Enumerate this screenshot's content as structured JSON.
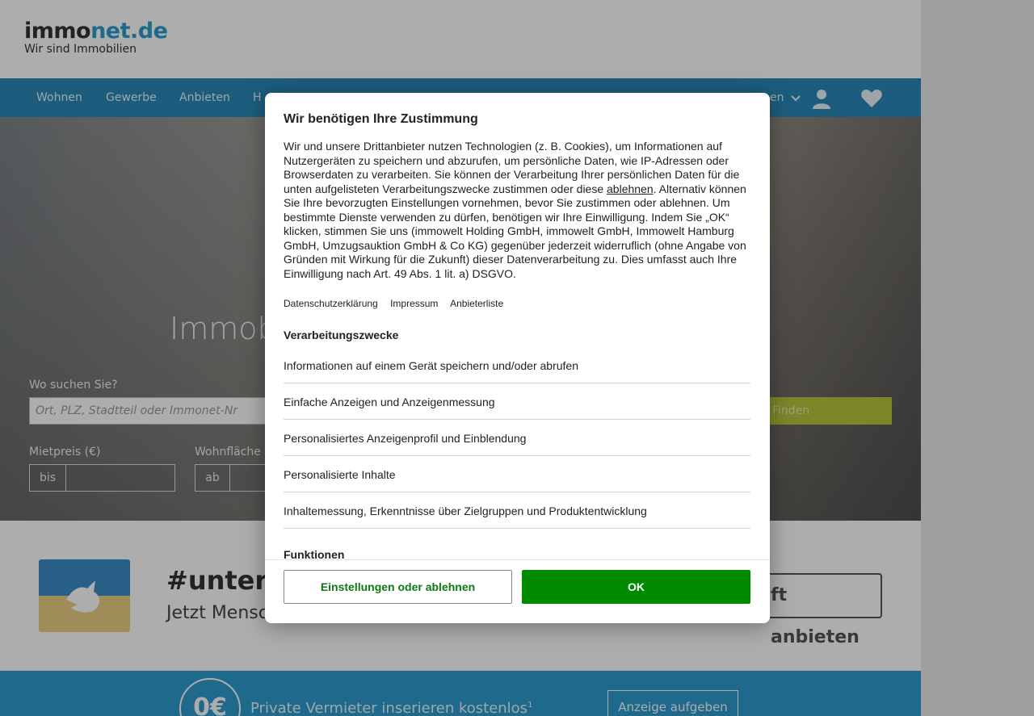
{
  "logo": {
    "brand_part1": "immo",
    "brand_part2": "net.de",
    "tagline": "Wir sind Immobilien"
  },
  "nav": {
    "items": [
      {
        "label": "Wohnen"
      },
      {
        "label": "Gewerbe"
      },
      {
        "label": "Anbieten"
      },
      {
        "label": "H"
      }
    ],
    "partial_right": "en",
    "icons": [
      "chevron-down-icon",
      "user-icon",
      "heart-icon"
    ]
  },
  "hero": {
    "title": "Immob",
    "search_label": "Wo suchen Sie?",
    "search_placeholder": "Ort, PLZ, Stadtteil oder Immonet-Nr",
    "find_label": "Finden",
    "rent_label": "Mietpreis (€)",
    "rent_prefix": "bis",
    "area_label": "Wohnfläche",
    "area_prefix": "ab"
  },
  "banner": {
    "title": "#unterk",
    "subtitle": "Jetzt Mensc",
    "button_label": "ft anbieten",
    "colors": {
      "flag_top": "#3c8dc6",
      "flag_bottom": "#ead083"
    }
  },
  "strip": {
    "badge": "0€",
    "text": "Private Vermieter inserieren kostenlos",
    "footnote_marker": "1",
    "button_label": "Anzeige aufgeben"
  },
  "consent": {
    "title": "Wir benötigen Ihre Zustimmung",
    "body_before": "Wir und unsere Drittanbieter nutzen Technologien (z. B. Cookies), um Informationen auf Nutzergeräten zu speichern und abzurufen, um persönliche Daten, wie IP-Adressen oder Browserdaten zu verarbeiten. Sie können der Verarbeitung Ihrer persönlichen Daten für die unten aufgelisteten Verarbeitungszwecke zustimmen oder diese ",
    "body_link": "ablehnen",
    "body_after": ". Alternativ können Sie Ihre bevorzugten Einstellungen vornehmen, bevor Sie zustimmen oder ablehnen. Um bestimmte Dienste verwenden zu dürfen, benötigen wir Ihre Einwilligung. Indem Sie „OK“ klicken, stimmen Sie uns (immowelt Holding GmbH, immowelt GmbH, Immowelt Hamburg GmbH, Umzugsauktion GmbH & Co KG) gegenüber jederzeit widerruflich (ohne Angabe von Gründen mit Wirkung für die Zukunft) dieser Datenverarbeitung zu. Dies umfasst auch Ihre Einwilligung nach Art. 49 Abs. 1 lit. a) DSGVO.",
    "links": [
      "Datenschutzerklärung",
      "Impressum",
      "Anbieterliste"
    ],
    "purposes_heading": "Verarbeitungszwecke",
    "purposes": [
      "Informationen auf einem Gerät speichern und/oder abrufen",
      "Einfache Anzeigen und Anzeigenmessung",
      "Personalisiertes Anzeigenprofil und Einblendung",
      "Personalisierte Inhalte",
      "Inhaltemessung, Erkenntnisse über Zielgruppen und Produktentwicklung"
    ],
    "functions_heading": "Funktionen",
    "settings_button": "Einstellungen oder ablehnen",
    "ok_button": "OK",
    "colors": {
      "ok": "#008a00",
      "settings_text": "#0d7a13"
    }
  }
}
